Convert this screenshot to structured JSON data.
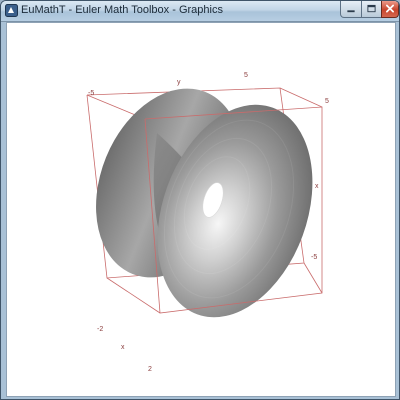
{
  "window": {
    "title": "EuMathT - Euler Math Toolbox - Graphics",
    "app_icon": "eumatht-app-icon",
    "controls": {
      "minimize_icon": "minimize-icon",
      "maximize_icon": "maximize-icon",
      "close_icon": "close-icon",
      "close_color": "#c8452d"
    }
  },
  "graphics": {
    "box_color": "#c96b6b",
    "labels": {
      "top_left": "-5",
      "top_y": "y",
      "top_right": "5",
      "right_top": "5",
      "right_x": "x",
      "right_bottom": "-5",
      "bottom_left": "-2",
      "bottom_x": "x",
      "bottom_z": "2"
    }
  }
}
